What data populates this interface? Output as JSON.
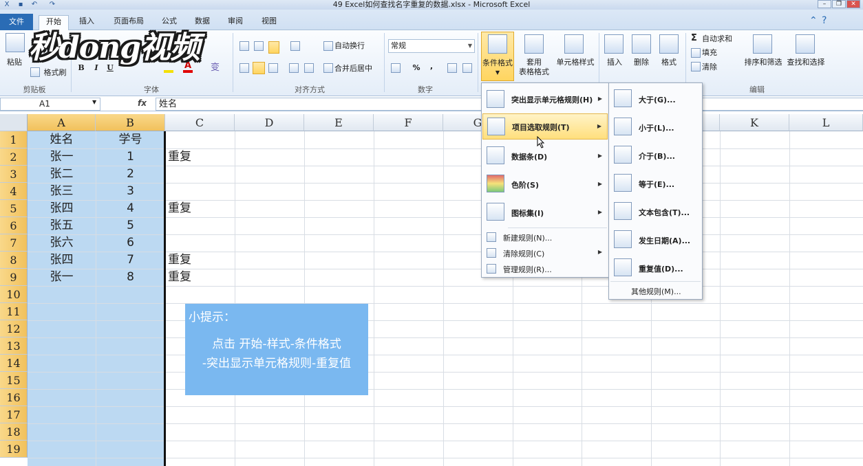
{
  "window": {
    "title": "49 Excel如何查找名字重复的数据.xlsx - Microsoft Excel"
  },
  "tabs": [
    "文件",
    "开始",
    "插入",
    "页面布局",
    "公式",
    "数据",
    "审阅",
    "视图"
  ],
  "ribbon": {
    "clipboard": {
      "paste": "粘贴",
      "format_painter": "格式刷",
      "label": "剪贴板"
    },
    "font": {
      "label": "字体",
      "bold": "B",
      "italic": "I",
      "underline": "U"
    },
    "alignment": {
      "wrap": "自动换行",
      "merge": "合并后居中",
      "label": "对齐方式"
    },
    "number": {
      "format": "常规",
      "percent": "%",
      "comma": ",",
      "label": "数字"
    },
    "styles": {
      "conditional": "条件格式",
      "table_line1": "套用",
      "table_line2": "表格格式",
      "cell_styles": "单元格样式"
    },
    "cells": {
      "insert": "插入",
      "delete": "删除",
      "format": "格式"
    },
    "editing": {
      "autosum": "自动求和",
      "fill": "填充",
      "clear": "清除",
      "sort": "排序和筛选",
      "find": "查找和选择",
      "label": "编辑"
    }
  },
  "logo_text": "秒dong视频",
  "formula_bar": {
    "name_box": "A1",
    "fx": "fx",
    "content": "姓名"
  },
  "columns": [
    "A",
    "B",
    "C",
    "D",
    "E",
    "F",
    "G",
    "H",
    "I",
    "J",
    "K",
    "L"
  ],
  "rows": [
    "1",
    "2",
    "3",
    "4",
    "5",
    "6",
    "7",
    "8",
    "9",
    "10",
    "11",
    "12",
    "13",
    "14",
    "15",
    "16",
    "17",
    "18",
    "19"
  ],
  "cells": {
    "A": [
      "姓名",
      "张一",
      "张二",
      "张三",
      "张四",
      "张五",
      "张六",
      "张四",
      "张一"
    ],
    "B": [
      "学号",
      "1",
      "2",
      "3",
      "4",
      "5",
      "6",
      "7",
      "8"
    ],
    "C": [
      "",
      "重复",
      "",
      "",
      "重复",
      "",
      "",
      "重复",
      "重复"
    ]
  },
  "tip": {
    "title": "小提示：",
    "line1": "点击 开始-样式-条件格式",
    "line2": "-突出显示单元格规则-重复值"
  },
  "cf_menu": {
    "items": [
      "突出显示单元格规则(H)",
      "项目选取规则(T)",
      "数据条(D)",
      "色阶(S)",
      "图标集(I)"
    ],
    "small": [
      "新建规则(N)...",
      "清除规则(C)",
      "管理规则(R)..."
    ]
  },
  "sub_menu": {
    "items": [
      "大于(G)...",
      "小于(L)...",
      "介于(B)...",
      "等于(E)...",
      "文本包含(T)...",
      "发生日期(A)...",
      "重复值(D)..."
    ],
    "other": "其他规则(M)..."
  },
  "colors": {
    "selection": "#bcd9f2",
    "tip_bg": "#7ab8f0",
    "header_selected": "#f1c15c",
    "file_tab": "#2a6cb5"
  }
}
